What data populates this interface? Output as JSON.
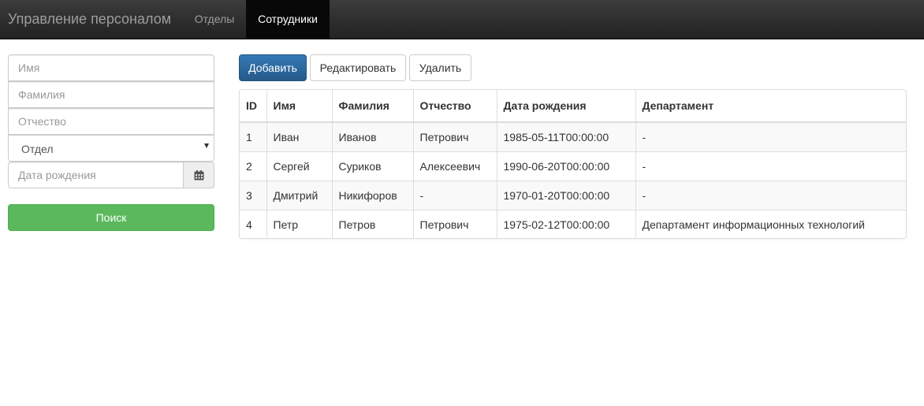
{
  "navbar": {
    "brand": "Управление персоналом",
    "items": [
      {
        "label": "Отделы",
        "active": false
      },
      {
        "label": "Сотрудники",
        "active": true
      }
    ]
  },
  "filters": {
    "first_name_placeholder": "Имя",
    "last_name_placeholder": "Фамилия",
    "middle_name_placeholder": "Отчество",
    "department_select": "Отдел",
    "birth_date_placeholder": "Дата рождения",
    "birth_date_icon": "calendar-icon",
    "search_label": "Поиск"
  },
  "toolbar": {
    "add_label": "Добавить",
    "edit_label": "Редактировать",
    "delete_label": "Удалить"
  },
  "table": {
    "headers": [
      "ID",
      "Имя",
      "Фамилия",
      "Отчество",
      "Дата рождения",
      "Департамент"
    ],
    "rows": [
      [
        "1",
        "Иван",
        "Иванов",
        "Петрович",
        "1985-05-11T00:00:00",
        "-"
      ],
      [
        "2",
        "Сергей",
        "Суриков",
        "Алексеевич",
        "1990-06-20T00:00:00",
        "-"
      ],
      [
        "3",
        "Дмитрий",
        "Никифоров",
        "-",
        "1970-01-20T00:00:00",
        "-"
      ],
      [
        "4",
        "Петр",
        "Петров",
        "Петрович",
        "1975-02-12T00:00:00",
        "Департамент информационных технологий"
      ]
    ]
  },
  "colors": {
    "navbar": "#222222",
    "primary": "#337ab7",
    "success": "#5cb85c"
  }
}
